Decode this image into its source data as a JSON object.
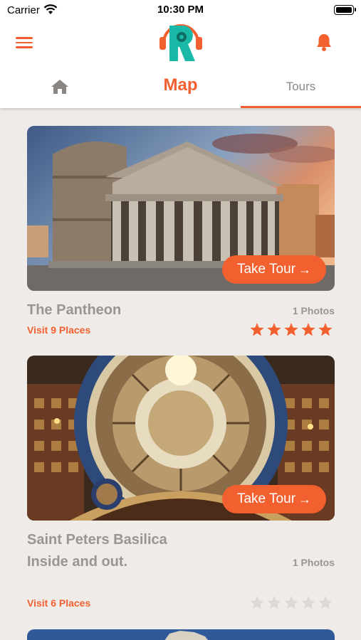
{
  "status_bar": {
    "carrier": "Carrier",
    "time": "10:30 PM"
  },
  "header": {
    "menu_icon": "hamburger-menu-icon",
    "logo_icon": "app-logo",
    "bell_icon": "bell-icon"
  },
  "tabs": {
    "home_icon": "home-icon",
    "map_label": "Map",
    "tours_label": "Tours",
    "active": "Tours"
  },
  "tours": [
    {
      "title": "The Pantheon",
      "photos": "1 Photos",
      "visit": "Visit 9 Places",
      "button": "Take Tour",
      "rating": 5
    },
    {
      "title": "Saint Peters Basilica Inside and out.",
      "photos": "1 Photos",
      "visit": "Visit 6 Places",
      "button": "Take Tour",
      "rating": 0
    }
  ],
  "colors": {
    "accent": "#f2602f",
    "muted": "#9a9594",
    "background": "#efebe9",
    "star_empty": "#ddd7d5"
  }
}
